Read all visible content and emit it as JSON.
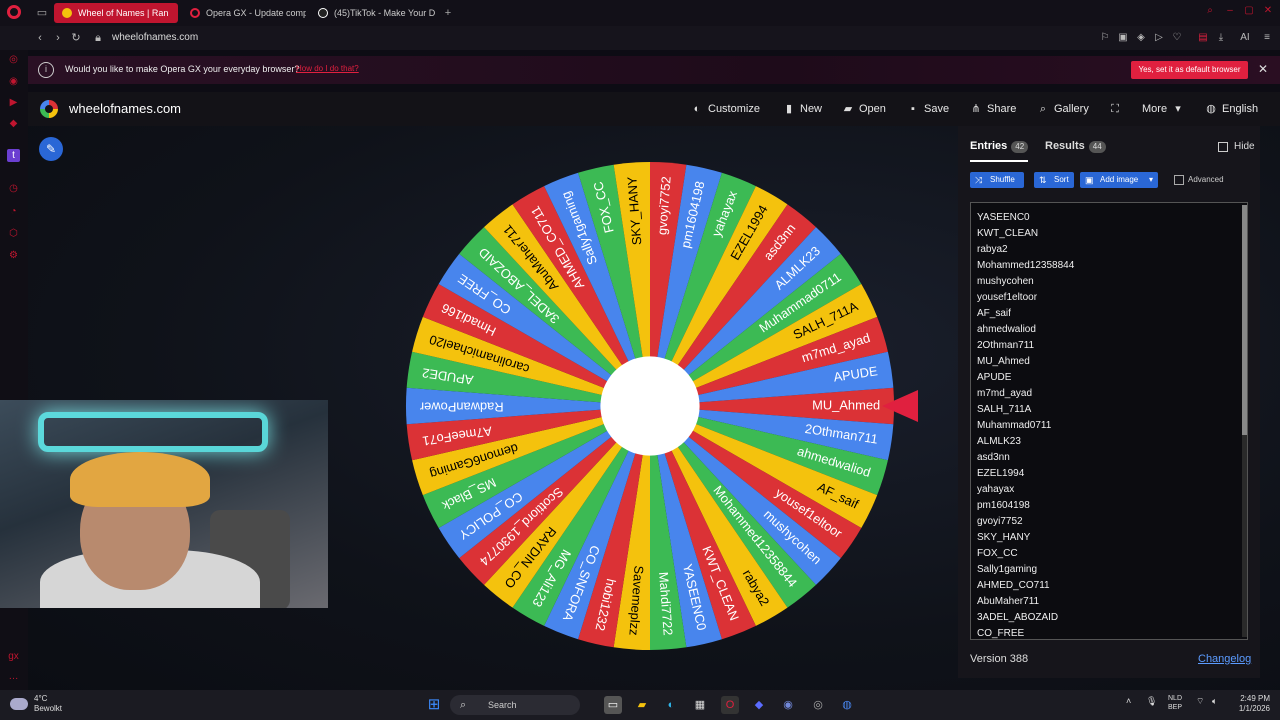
{
  "browser": {
    "tabs": [
      {
        "label": "Wheel of Names | Ran",
        "active": true
      },
      {
        "label": "Opera GX - Update comp",
        "active": false
      },
      {
        "label": "(45)TikTok - Make Your D",
        "active": false
      }
    ],
    "url": "wheelofnames.com"
  },
  "banner": {
    "text": "Would you like to make Opera GX your everyday browser?",
    "link": "How do I do that?",
    "button": "Yes, set it as default browser"
  },
  "app": {
    "logo": "wheelofnames.com",
    "menu": [
      {
        "label": "Customize",
        "icon": "palette-icon"
      },
      {
        "label": "New",
        "icon": "file-icon"
      },
      {
        "label": "Open",
        "icon": "folder-icon"
      },
      {
        "label": "Save",
        "icon": "save-icon"
      },
      {
        "label": "Share",
        "icon": "share-icon"
      },
      {
        "label": "Gallery",
        "icon": "search-icon"
      },
      {
        "label": "",
        "icon": "fullscreen-icon"
      },
      {
        "label": "More",
        "icon": "chevron-down-icon"
      },
      {
        "label": "English",
        "icon": "globe-icon"
      }
    ]
  },
  "panel": {
    "tab_entries": "Entries",
    "entries_count": "42",
    "tab_results": "Results",
    "results_count": "44",
    "hide": "Hide",
    "shuffle": "Shuffle",
    "sort": "Sort",
    "add_image": "Add image",
    "advanced": "Advanced",
    "entries": [
      "YASEENC0",
      "KWT_CLEAN",
      "rabya2",
      "Mohammed12358844",
      "mushycohen",
      "yousef1eltoor",
      "AF_saif",
      "ahmedwaliod",
      "2Othman711",
      "MU_Ahmed",
      "APUDE",
      "m7md_ayad",
      "SALH_711A",
      "Muhammad0711",
      "ALMLK23",
      "asd3nn",
      "EZEL1994",
      "yahayax",
      "pm1604198",
      "gvoyi7752",
      "SKY_HANY",
      "FOX_CC",
      "Sally1gaming",
      "AHMED_CO711",
      "AbuMaher711",
      "3ADEL_ABOZAID",
      "CO_FREE"
    ],
    "version": "Version 388",
    "changelog": "Changelog"
  },
  "wheel": {
    "segments": [
      "MU_Ahmed",
      "2Othman711",
      "ahmedwaliod",
      "AF_saif",
      "yousef1eltoor",
      "mushycohen",
      "Mohammed12358844",
      "rabya2",
      "KWT_CLEAN",
      "YASEENC0",
      "Mahdi7722",
      "Savemeplzz",
      "hobi1232",
      "CO_SNFORA",
      "MG_Ali123",
      "RAYDIN_CO",
      "Scottiord_1930774",
      "CO_POLICY",
      "MS_Black",
      "demon6Gaming",
      "A7meeFo71",
      "RadwanPower",
      "APUDE2",
      "carolinamichael20",
      "Hmadi166",
      "CO_FREE",
      "3ADEL_ABOZAID",
      "AbuMaher711",
      "AHMED_CO711",
      "Sally1gaming",
      "FOX_CC",
      "SKY_HANY",
      "gvoyi7752",
      "pm1604198",
      "yahayax",
      "EZEL1994",
      "asd3nn",
      "ALMLK23",
      "Muhammad0711",
      "SALH_711A",
      "m7md_ayad",
      "APUDE"
    ],
    "colors": [
      "#db3236",
      "#4885ed",
      "#3cba54",
      "#f4c20d"
    ]
  },
  "taskbar": {
    "temp": "4°C",
    "weather": "Bewolkt",
    "search": "Search",
    "lang_top": "NLD",
    "lang_bottom": "BEP",
    "time": "2:49 PM",
    "date": "1/1/2026"
  }
}
